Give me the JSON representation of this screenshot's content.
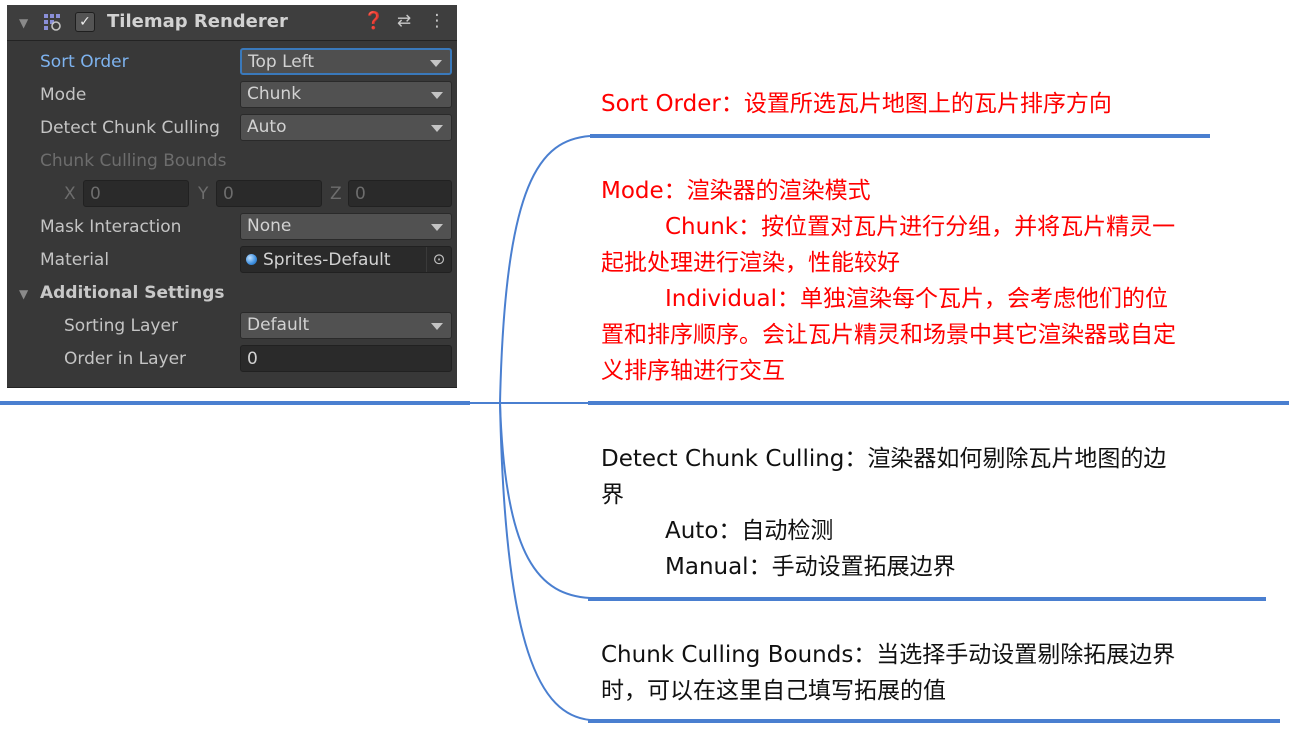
{
  "inspector": {
    "component_title": "Tilemap Renderer",
    "header_icons": [
      "foldout-arrow-icon",
      "tilemap-component-icon",
      "enabled-checkbox-icon",
      "help-icon",
      "presets-icon",
      "more-menu-icon"
    ],
    "enabled_mark": "✓",
    "help_glyph": "❓",
    "presets_glyph": "⇄",
    "menu_glyph": "⋮",
    "properties": {
      "sort_order": {
        "label": "Sort Order",
        "value": "Top Left"
      },
      "mode": {
        "label": "Mode",
        "value": "Chunk"
      },
      "detect_chunk_culling": {
        "label": "Detect Chunk Culling",
        "value": "Auto"
      },
      "chunk_culling_bounds": {
        "label": "Chunk Culling Bounds",
        "x_label": "X",
        "x_value": "0",
        "y_label": "Y",
        "y_value": "0",
        "z_label": "Z",
        "z_value": "0"
      },
      "mask_interaction": {
        "label": "Mask Interaction",
        "value": "None"
      },
      "material": {
        "label": "Material",
        "value": "Sprites-Default",
        "picker_glyph": "⊙"
      }
    },
    "additional_settings": {
      "label": "Additional Settings",
      "sorting_layer": {
        "label": "Sorting Layer",
        "value": "Default"
      },
      "order_in_layer": {
        "label": "Order in Layer",
        "value": "0"
      }
    },
    "colors": {
      "panel_bg": "#383838",
      "highlight_label": "#7eb3ef",
      "focus_border": "#3a79bb"
    }
  },
  "notes": {
    "sort_order": {
      "line1": "Sort Order：设置所选瓦片地图上的瓦片排序方向"
    },
    "mode": {
      "line1": "Mode：渲染器的渲染模式",
      "line2": "Chunk：按位置对瓦片进行分组，并将瓦片精灵一",
      "line3": "起批处理进行渲染，性能较好",
      "line4": "Individual：单独渲染每个瓦片，会考虑他们的位",
      "line5": "置和排序顺序。会让瓦片精灵和场景中其它渲染器或自定",
      "line6": "义排序轴进行交互"
    },
    "detect_chunk_culling": {
      "line1": "Detect Chunk Culling：渲染器如何剔除瓦片地图的边",
      "line2": "界",
      "line3": "Auto：自动检测",
      "line4": "Manual：手动设置拓展边界"
    },
    "chunk_culling_bounds": {
      "line1": "Chunk Culling Bounds：当选择手动设置剔除拓展边界",
      "line2": "时，可以在这里自己填写拓展的值"
    },
    "colors": {
      "red_text": "#ff0000",
      "black_text": "#111111",
      "connector_line": "#4a7fd0"
    }
  }
}
